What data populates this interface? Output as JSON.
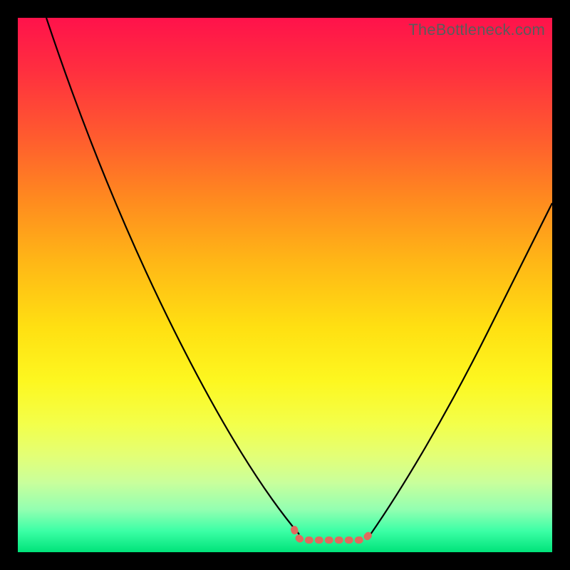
{
  "watermark": "TheBottleneck.com",
  "colors": {
    "curve": "#000000",
    "marker": "#e06a5e",
    "frame": "#000000"
  },
  "chart_data": {
    "type": "line",
    "title": "",
    "xlabel": "",
    "ylabel": "",
    "xlim": [
      0,
      100
    ],
    "ylim": [
      0,
      100
    ],
    "grid": false,
    "legend": false,
    "series": [
      {
        "name": "left-curve",
        "x": [
          0,
          2,
          4,
          6,
          8,
          10,
          12,
          14,
          16,
          18,
          20,
          22,
          24,
          28,
          32,
          36,
          40,
          44,
          48,
          50,
          51,
          52,
          53
        ],
        "values": [
          100,
          97,
          94,
          91,
          87,
          84,
          80,
          76,
          72,
          68,
          64,
          60,
          56,
          48,
          40,
          33,
          26,
          19,
          12,
          8,
          6,
          4,
          3
        ]
      },
      {
        "name": "right-curve",
        "x": [
          65,
          66,
          68,
          70,
          73,
          76,
          80,
          84,
          88,
          92,
          96,
          100
        ],
        "values": [
          3,
          5,
          8,
          12,
          17,
          22,
          29,
          36,
          43,
          50,
          58,
          65
        ]
      },
      {
        "name": "bottom-flat",
        "x": [
          51,
          55,
          59,
          63,
          66
        ],
        "values": [
          2,
          2,
          2,
          2,
          3
        ]
      }
    ],
    "annotations": []
  }
}
